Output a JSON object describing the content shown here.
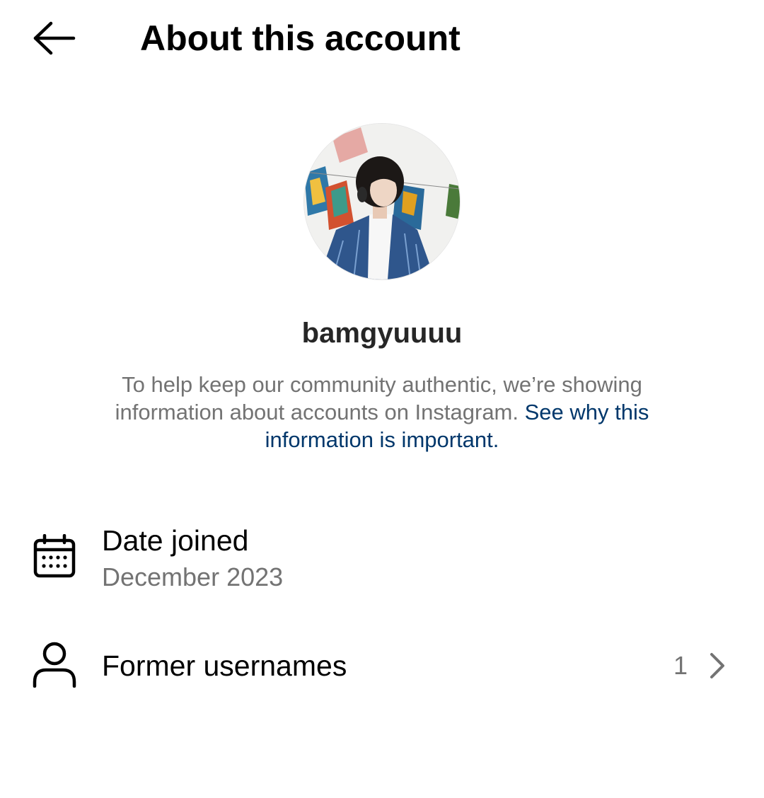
{
  "header": {
    "back_icon": "arrow-left-icon",
    "title": "About this account"
  },
  "profile": {
    "username": "bamgyuuuu",
    "info_text": "To help keep our community authentic, we’re showing information about accounts on Instagram.",
    "info_link": "See why this information is important."
  },
  "details": {
    "date_joined": {
      "icon": "calendar-icon",
      "label": "Date joined",
      "value": "December 2023"
    },
    "former_usernames": {
      "icon": "person-icon",
      "label": "Former usernames",
      "count": "1",
      "chevron_icon": "chevron-right-icon"
    }
  },
  "colors": {
    "text_primary": "#000000",
    "text_secondary": "#737373",
    "link": "#00376b"
  }
}
